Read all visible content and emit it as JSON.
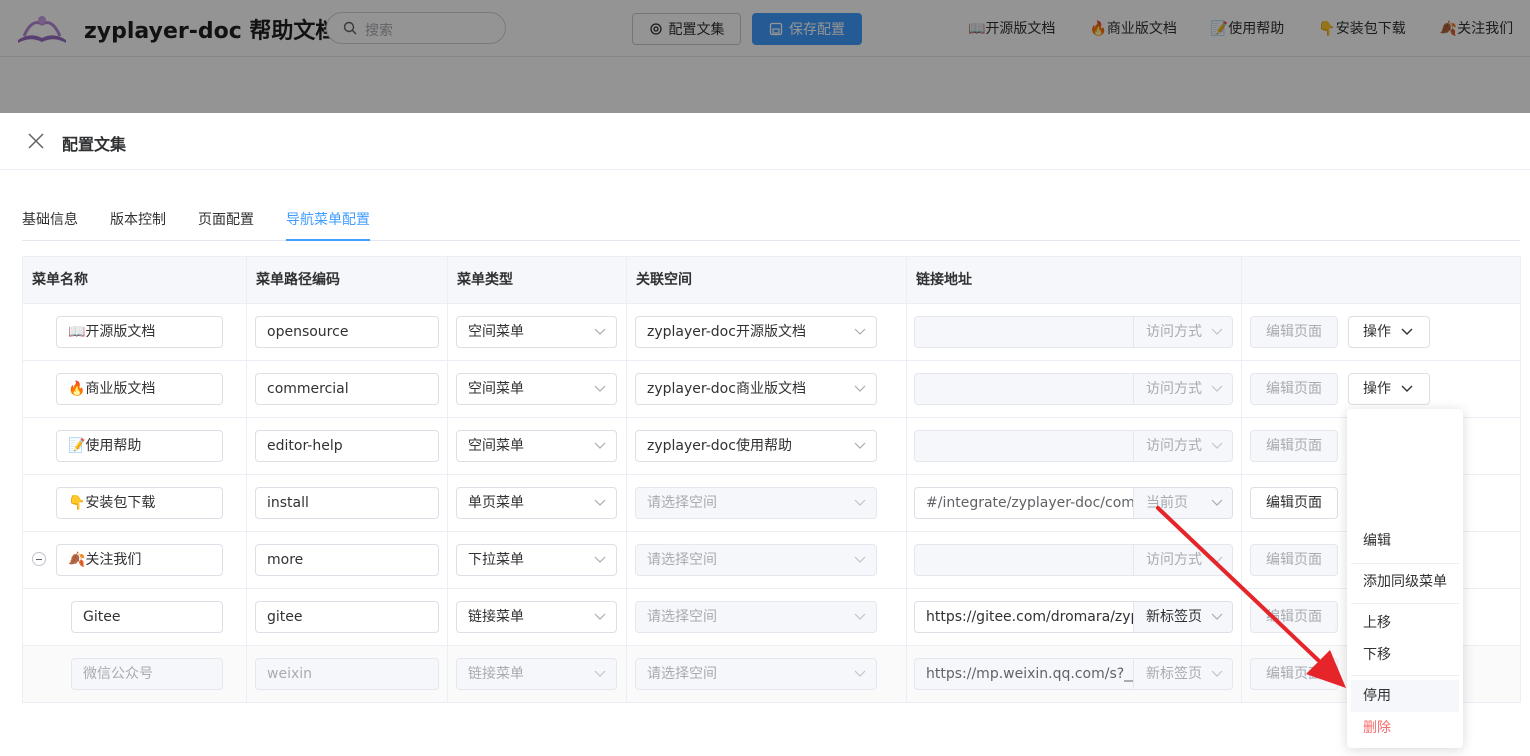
{
  "header": {
    "site_title": "zyplayer-doc 帮助文档",
    "search_placeholder": "搜索",
    "config_button": "配置文集",
    "save_button": "保存配置",
    "nav_links": [
      "📖开源版文档",
      "🔥商业版文档",
      "📝使用帮助",
      "👇安装包下载",
      "🍂关注我们"
    ]
  },
  "drawer": {
    "title": "配置文集",
    "tabs": [
      "基础信息",
      "版本控制",
      "页面配置",
      "导航菜单配置"
    ],
    "active_tab": "导航菜单配置"
  },
  "table": {
    "columns": [
      "菜单名称",
      "菜单路径编码",
      "菜单类型",
      "关联空间",
      "链接地址"
    ],
    "edit_label": "编辑页面",
    "op_label": "操作",
    "rows": [
      {
        "name": "📖开源版文档",
        "code": "opensource",
        "type": "空间菜单",
        "space": "zyplayer-doc开源版文档",
        "url": "",
        "mode": "访问方式"
      },
      {
        "name": "🔥商业版文档",
        "code": "commercial",
        "type": "空间菜单",
        "space": "zyplayer-doc商业版文档",
        "url": "",
        "mode": "访问方式"
      },
      {
        "name": "📝使用帮助",
        "code": "editor-help",
        "type": "空间菜单",
        "space": "zyplayer-doc使用帮助",
        "url": "",
        "mode": "访问方式"
      },
      {
        "name": "👇安装包下载",
        "code": "install",
        "type": "单页菜单",
        "space": "请选择空间",
        "url": "#/integrate/zyplayer-doc/comm",
        "mode": "当前页"
      },
      {
        "name": "🍂关注我们",
        "code": "more",
        "type": "下拉菜单",
        "space": "请选择空间",
        "url": "",
        "mode": "访问方式"
      },
      {
        "name": "Gitee",
        "code": "gitee",
        "type": "链接菜单",
        "space": "请选择空间",
        "url": "https://gitee.com/dromara/zypl",
        "mode": "新标签页"
      },
      {
        "name": "微信公众号",
        "code": "weixin",
        "type": "链接菜单",
        "space": "请选择空间",
        "url": "https://mp.weixin.qq.com/s?__b",
        "mode": "新标签页"
      }
    ]
  },
  "dropdown": {
    "items": [
      "编辑",
      "添加同级菜单",
      "上移",
      "下移",
      "停用",
      "删除"
    ]
  },
  "colors": {
    "primary": "#409eff",
    "danger": "#f56c6c",
    "annotation_arrow": "#e5252a"
  }
}
